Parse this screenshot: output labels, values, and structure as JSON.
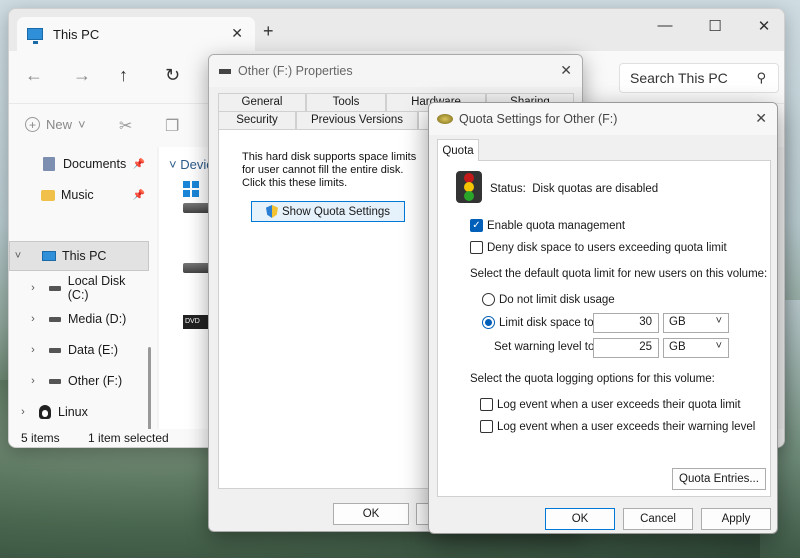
{
  "explorer": {
    "tab_title": "This PC",
    "new_tab": "+",
    "search_placeholder": "Search This PC",
    "toolbar_new": "New",
    "sidebar": {
      "documents": "Documents",
      "music": "Music",
      "this_pc": "This PC",
      "local_disk": "Local Disk (C:)",
      "media": "Media (D:)",
      "data": "Data (E:)",
      "other": "Other (F:)",
      "linux": "Linux"
    },
    "devices_label": "Devic",
    "dvd_label": "DVD",
    "status_items": "5 items",
    "status_selected": "1 item selected"
  },
  "properties": {
    "title": "Other (F:) Properties",
    "tabs_row1": [
      "General",
      "Tools",
      "Hardware",
      "Sharing"
    ],
    "tabs_row2": [
      "Security",
      "Previous Versions"
    ],
    "quota_text": "This hard disk supports space limits for user cannot fill the entire disk. Click this these limits.",
    "show_quota_button": "Show Quota Settings",
    "ok_button": "OK"
  },
  "quota": {
    "title": "Quota Settings for Other (F:)",
    "tab": "Quota",
    "status_label": "Status:",
    "status_value": "Disk quotas are disabled",
    "enable_label": "Enable quota management",
    "enable_checked": true,
    "deny_label": "Deny disk space to users exceeding quota limit",
    "deny_checked": false,
    "default_limit_heading": "Select the default quota limit for new users on this volume:",
    "no_limit_label": "Do not limit disk usage",
    "limit_label": "Limit disk space to",
    "limit_value": "30",
    "limit_unit": "GB",
    "warning_label": "Set warning level to",
    "warning_value": "25",
    "warning_unit": "GB",
    "logging_heading": "Select the quota logging options for this volume:",
    "log_limit_label": "Log event when a user exceeds their quota limit",
    "log_warning_label": "Log event when a user exceeds their warning level",
    "entries_button": "Quota Entries...",
    "ok_button": "OK",
    "cancel_button": "Cancel",
    "apply_button": "Apply"
  }
}
